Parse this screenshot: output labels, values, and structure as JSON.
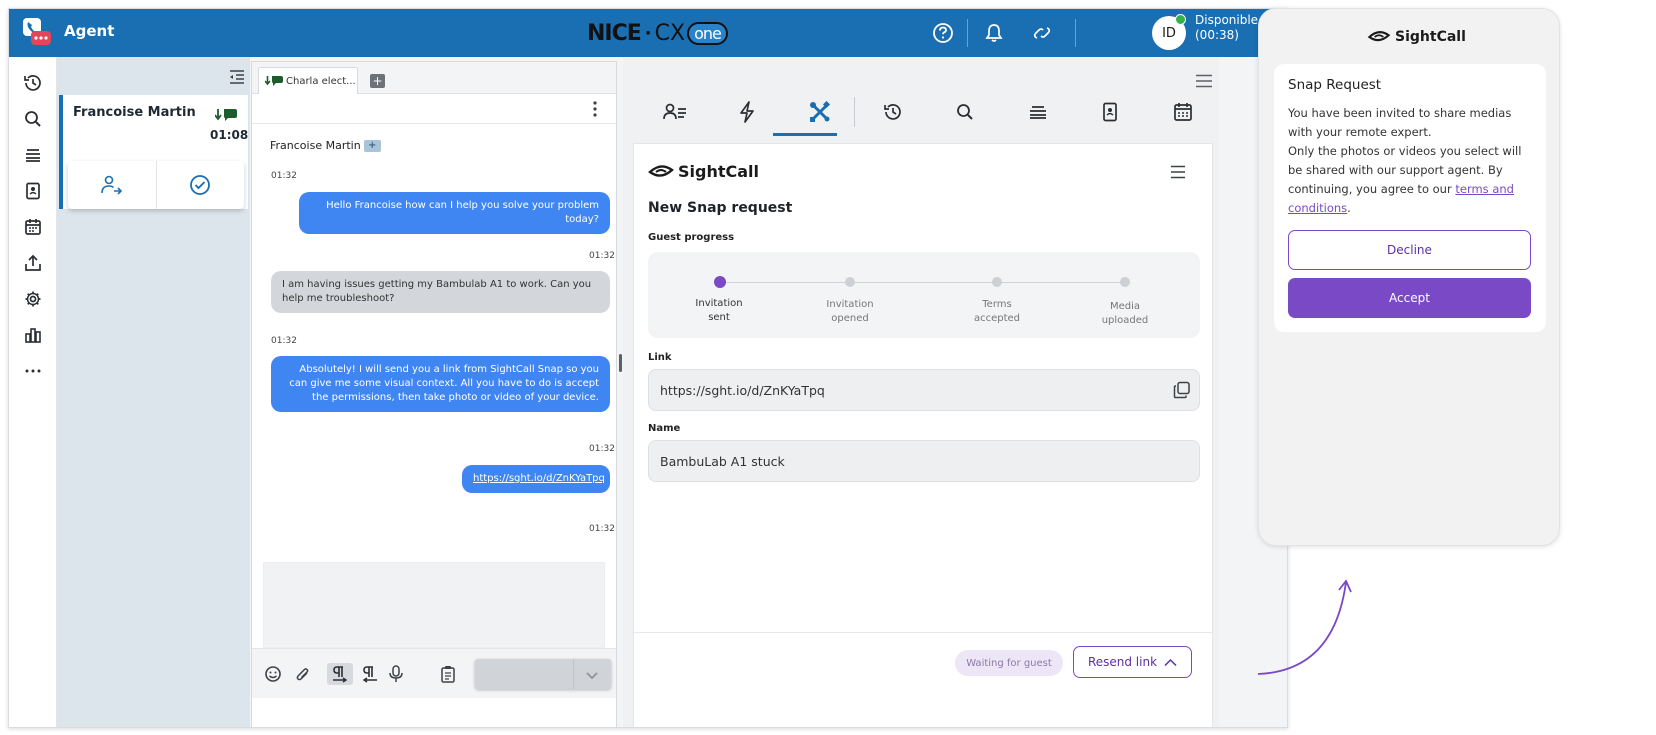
{
  "topbar": {
    "agent_label": "Agent",
    "brand_nice": "NICE",
    "brand_dot": "·",
    "brand_cx": "CX",
    "brand_one": "one",
    "avatar_initials": "ID",
    "status": "Disponible",
    "status_timer": "(00:38)",
    "icons": [
      "help-icon",
      "bell-icon",
      "link-broken-icon"
    ]
  },
  "leftnav": {
    "items": [
      "history-icon",
      "search-icon",
      "queue-icon",
      "address-book-icon",
      "calendar-icon",
      "upload-icon",
      "settings-icon",
      "chart-icon",
      "more-icon"
    ]
  },
  "contacts": {
    "name": "Francoise Martin",
    "time": "01:08"
  },
  "chat": {
    "tab_label": "Charla elect...",
    "add_label": "+",
    "customer_name": "Francoise Martin",
    "customer_badge": "+",
    "messages": [
      {
        "time": "01:32",
        "from": "agent",
        "text": "Hello Francoise how can I help you solve your problem today?"
      },
      {
        "time": "01:32",
        "from": "customer",
        "text": "I am having issues getting my Bambulab A1 to work. Can you help me troubleshoot?"
      },
      {
        "time": "01:32",
        "from": "agent",
        "text": "Absolutely! I will send you a link from SightCall Snap so you can give me some visual context. All you have to do is accept the permissions, then take photo or video of your device."
      },
      {
        "time": "01:32",
        "from": "agent",
        "text": "https://sght.io/d/ZnKYaTpq"
      }
    ],
    "last_time": "01:32"
  },
  "workspace": {
    "tabs": [
      "contact-card-icon",
      "lightning-icon",
      "tools-icon",
      "history-icon",
      "search-icon",
      "queue-icon",
      "address-book-icon",
      "calendar-icon"
    ],
    "active_tab": 2
  },
  "sightcall": {
    "brand": "SightCall",
    "title": "New Snap request",
    "guest_progress_label": "Guest progress",
    "steps": [
      {
        "line1": "Invitation",
        "line2": "sent",
        "active": true
      },
      {
        "line1": "Invitation",
        "line2": "opened",
        "active": false
      },
      {
        "line1": "Terms",
        "line2": "accepted",
        "active": false
      },
      {
        "line1": "Media",
        "line2": "uploaded",
        "active": false
      }
    ],
    "link_label": "Link",
    "link_value": "https://sght.io/d/ZnKYaTpq",
    "name_label": "Name",
    "name_value": "BambuLab A1 stuck",
    "waiting_label": "Waiting for guest",
    "resend_label": "Resend link"
  },
  "phone": {
    "brand": "SightCall",
    "title": "Snap Request",
    "body_1": "You have been invited to share medias with your remote expert.",
    "body_2": "Only the photos or videos you select will be shared with our support agent. By continuing, you agree to our ",
    "terms_link": "terms and conditions",
    "body_end": ".",
    "decline_label": "Decline",
    "accept_label": "Accept"
  },
  "colors": {
    "topbar": "#1a6fb3",
    "agent_bubble": "#3f86f2",
    "customer_bubble": "#d3d6da",
    "accent_purple": "#7a49c6"
  }
}
